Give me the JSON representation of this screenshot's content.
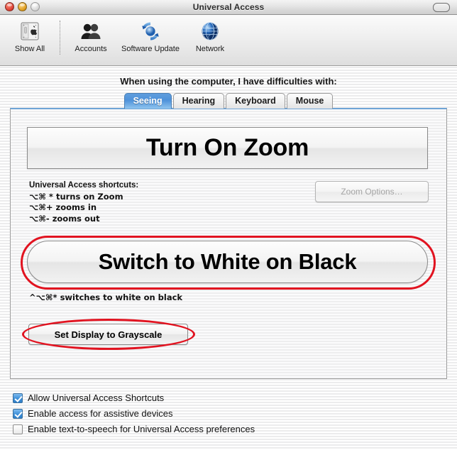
{
  "window": {
    "title": "Universal Access",
    "traffic_lights": [
      "close-button",
      "minimize-button",
      "zoom-button"
    ],
    "toolbar_toggle": "toolbar-toggle-pill"
  },
  "toolbar": {
    "items": [
      {
        "label": "Show All",
        "icon": "apple-show-all-icon"
      },
      {
        "label": "Accounts",
        "icon": "accounts-people-icon"
      },
      {
        "label": "Software Update",
        "icon": "software-update-refresh-icon"
      },
      {
        "label": "Network",
        "icon": "network-globe-icon"
      }
    ]
  },
  "main": {
    "prompt": "When using the computer, I have difficulties with:",
    "tabs": [
      {
        "label": "Seeing",
        "selected": true
      },
      {
        "label": "Hearing",
        "selected": false
      },
      {
        "label": "Keyboard",
        "selected": false
      },
      {
        "label": "Mouse",
        "selected": false
      }
    ],
    "seeing": {
      "zoom_button": "Turn On Zoom",
      "shortcuts_heading": "Universal Access shortcuts:",
      "shortcut_lines": [
        "⌥⌘ * turns on Zoom",
        "⌥⌘+ zooms in",
        "⌥⌘- zooms out"
      ],
      "zoom_options_button": "Zoom Options…",
      "zoom_options_enabled": false,
      "white_on_black_button": "Switch to White on Black",
      "white_on_black_note": "^⌥⌘* switches to white on black",
      "grayscale_button": "Set Display to Grayscale"
    }
  },
  "footer": {
    "checkboxes": [
      {
        "label": "Allow Universal Access Shortcuts",
        "checked": true
      },
      {
        "label": "Enable access for assistive devices",
        "checked": true
      },
      {
        "label": "Enable text-to-speech for Universal Access preferences",
        "checked": false
      }
    ]
  },
  "annotations": {
    "color": "#e11320",
    "marks": [
      {
        "target": "white-on-black-button",
        "shape": "ellipse"
      },
      {
        "target": "grayscale-button",
        "shape": "ellipse"
      }
    ]
  }
}
